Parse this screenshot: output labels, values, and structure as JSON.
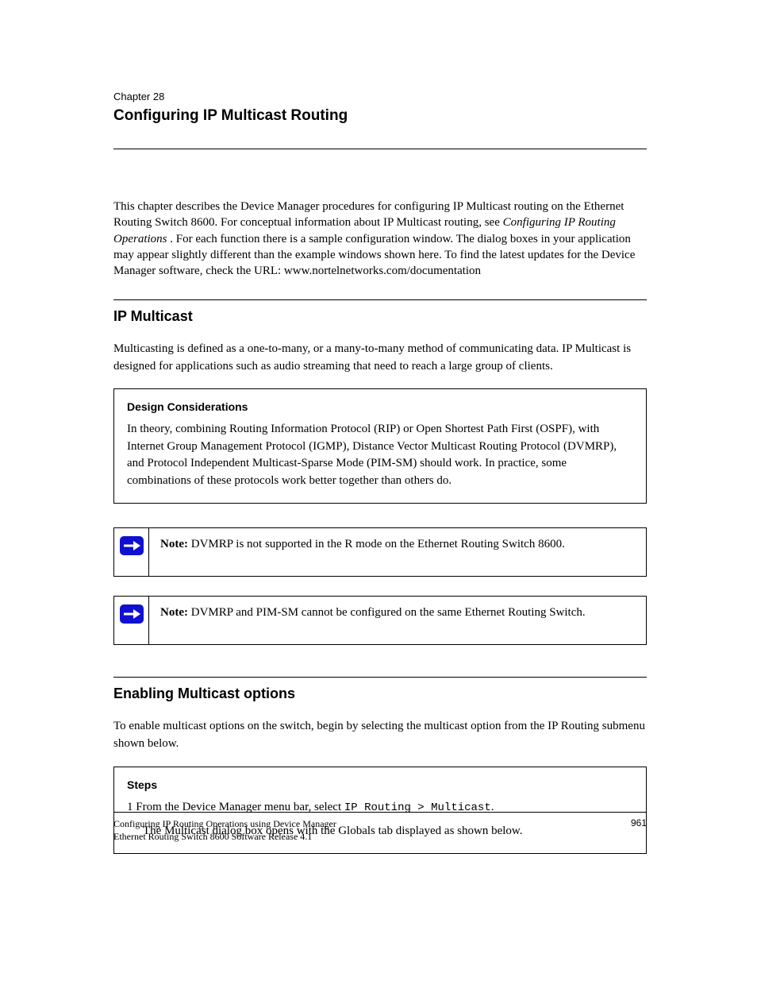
{
  "chapter": {
    "label": "Chapter 28",
    "title": "Configuring IP Multicast Routing"
  },
  "intro": {
    "p1_prefix": "This chapter describes the Device Manager procedures for configuring IP Multicast routing on the Ethernet Routing Switch 8600. For conceptual information about IP Multicast routing, see ",
    "p1_em": "Configuring IP Routing Operations",
    "p1_suffix": ". For each function there is a sample configuration window. The dialog boxes in your application may appear slightly different than the example windows shown here. To find the latest updates for the Device Manager software, check the URL: ",
    "p1_url": "www.nortelnetworks.com/documentation"
  },
  "section1": {
    "title": "IP Multicast",
    "p1": "Multicasting is defined as a one-to-many, or a many-to-many method of communicating data. IP Multicast is designed for applications such as audio streaming that need to reach a large group of clients.",
    "considerations": {
      "title": "Design Considerations",
      "body": "In theory, combining Routing Information Protocol (RIP) or Open Shortest Path First (OSPF), with Internet Group Management Protocol (IGMP), Distance Vector Multicast Routing Protocol (DVMRP), and Protocol Independent Multicast-Sparse Mode (PIM-SM) should work. In practice, some combinations of these protocols work better together than others do."
    },
    "note1": {
      "label": "Note:",
      "text": " DVMRP is not supported in the R mode on the Ethernet Routing Switch 8600."
    },
    "note2": {
      "label": "Note:",
      "text": " DVMRP and PIM-SM cannot be configured on the same Ethernet Routing Switch."
    }
  },
  "section2": {
    "title": "Enabling Multicast options",
    "p1": "To enable multicast options on the switch, begin by selecting the multicast option from the IP Routing submenu shown below.",
    "steps_title": "Steps",
    "step1_prefix": "1   From the Device Manager menu bar, select ",
    "step1_code": "IP Routing > Multicast",
    "step1_suffix": ".",
    "step1_note": "The Multicast dialog box opens with the Globals tab displayed as shown below."
  },
  "footer": {
    "left_line1": "Configuring IP Routing Operations using Device Manager",
    "left_line2": "Ethernet Routing Switch 8600 Software Release 4.1",
    "right": "961"
  }
}
